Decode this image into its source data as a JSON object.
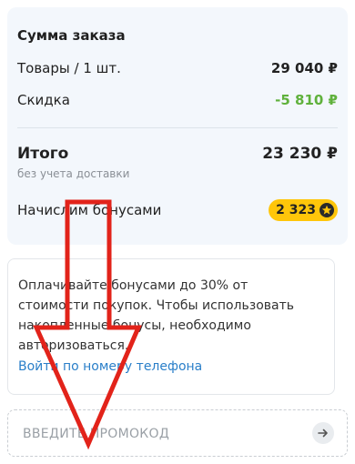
{
  "summary": {
    "title": "Сумма заказа",
    "goods_label": "Товары / 1 шт.",
    "goods_value": "29 040 ₽",
    "discount_label": "Скидка",
    "discount_value": "-5 810 ₽",
    "total_label": "Итого",
    "total_value": "23 230 ₽",
    "total_note": "без учета доставки",
    "bonus_label": "Начислим бонусами",
    "bonus_value": "2 323"
  },
  "bonus_info": {
    "text": "Оплачивайте бонусами до 30% от стоимости покупок. Чтобы использовать накопленные бонусы, необходимо авторизоваться.",
    "login_link": "Войти по номеру телефона"
  },
  "promo": {
    "placeholder": "ВВЕДИТЕ ПРОМОКОД"
  },
  "icons": {
    "bonus": "star-coin-icon",
    "submit": "arrow-right-icon"
  },
  "colors": {
    "discount": "#5fb13c",
    "bonus_badge": "#ffc60a",
    "link": "#2a7fc9",
    "annotation_arrow": "#e2231a"
  }
}
